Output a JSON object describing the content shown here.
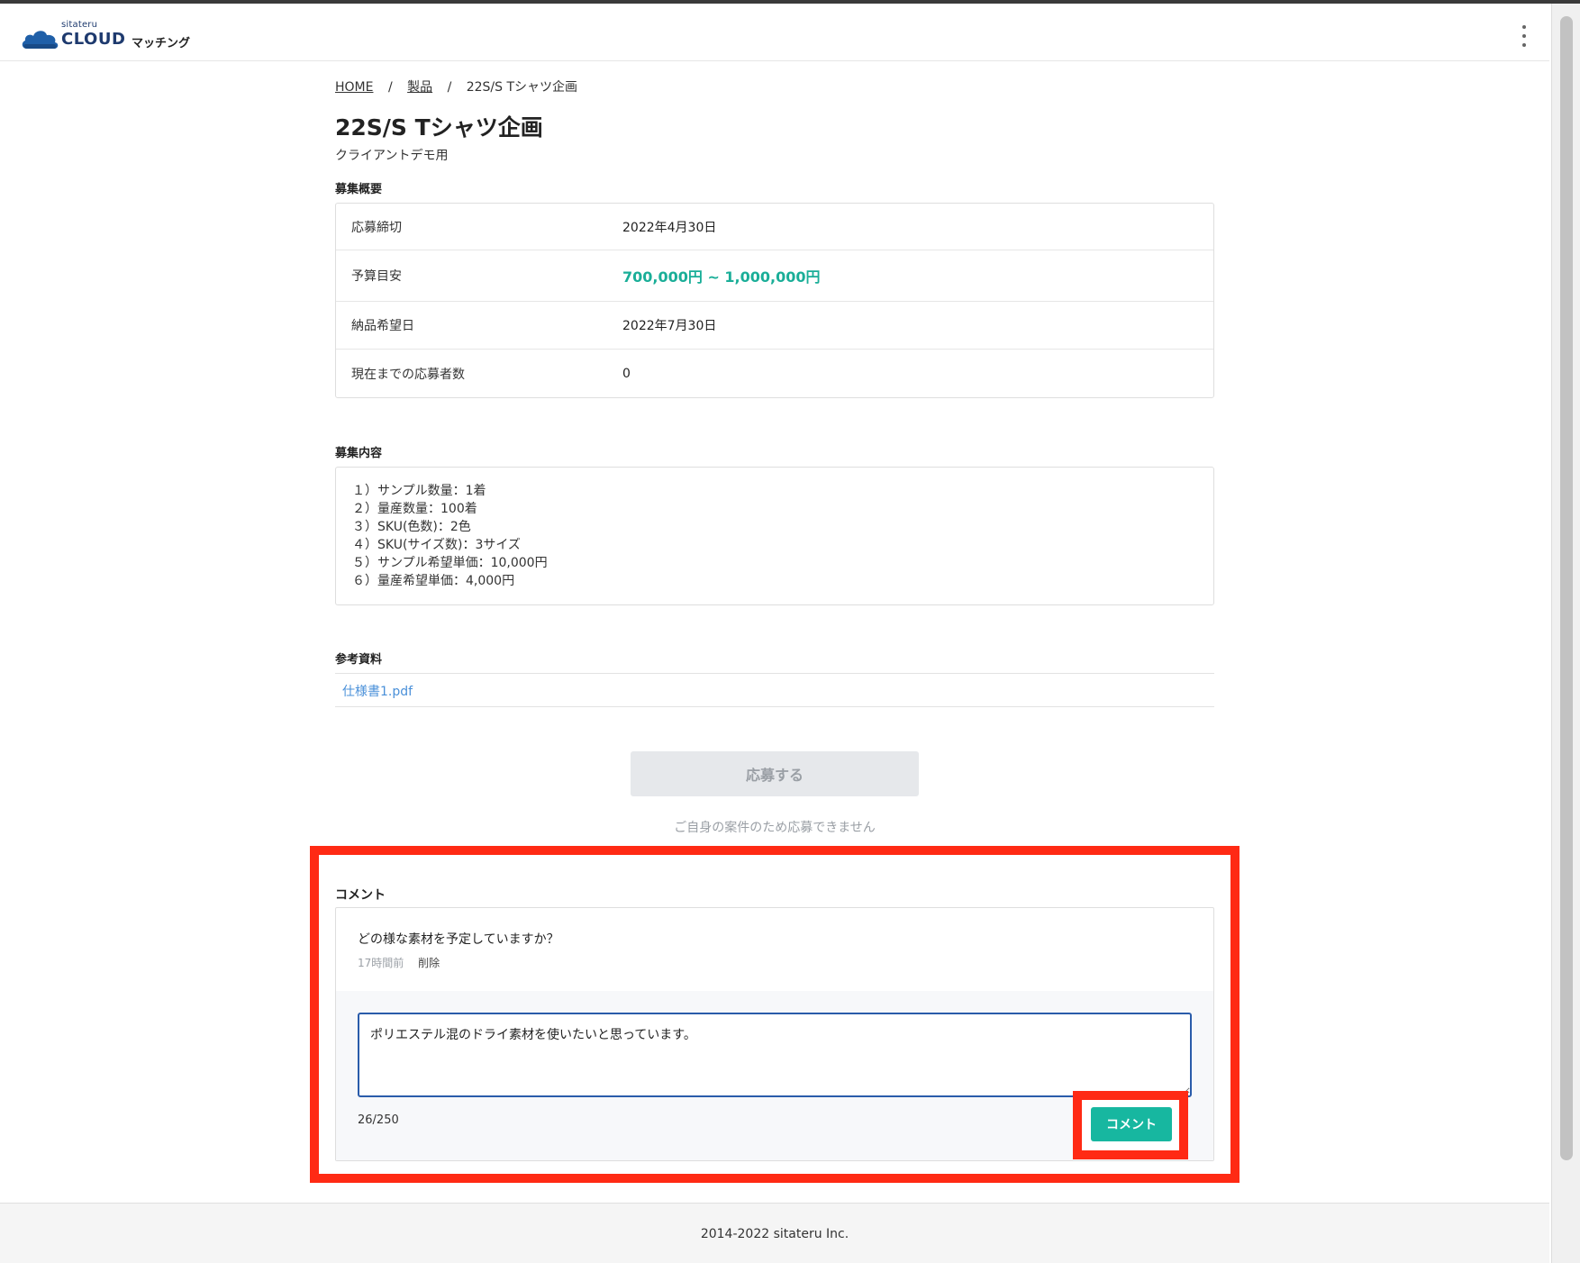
{
  "header": {
    "logo_small": "sitateru",
    "logo_big": "CLOUD",
    "logo_sub": "マッチング",
    "menu_icon": "kebab-menu-icon"
  },
  "breadcrumb": {
    "home": "HOME",
    "separator": "/",
    "products": "製品",
    "current": "22S/S Tシャツ企画"
  },
  "page": {
    "title": "22S/S Tシャツ企画",
    "subtitle": "クライアントデモ用"
  },
  "summary": {
    "heading": "募集概要",
    "rows": [
      {
        "label": "応募締切",
        "value": "2022年4月30日"
      },
      {
        "label": "予算目安",
        "value": "700,000円 ~ 1,000,000円"
      },
      {
        "label": "納品希望日",
        "value": "2022年7月30日"
      },
      {
        "label": "現在までの応募者数",
        "value": "0"
      }
    ]
  },
  "details": {
    "heading": "募集内容",
    "lines": [
      "１）サンプル数量：1着",
      "２）量産数量：100着",
      "３）SKU(色数)：2色",
      "４）SKU(サイズ数)：3サイズ",
      "５）サンプル希望単価：10,000円",
      "６）量産希望単価：4,000円"
    ]
  },
  "references": {
    "heading": "参考資料",
    "files": [
      "仕様書1.pdf"
    ]
  },
  "apply": {
    "button_label": "応募する",
    "note": "ご自身の案件のため応募できません"
  },
  "comments": {
    "heading": "コメント",
    "items": [
      {
        "text": "どの様な素材を予定していますか？",
        "time": "17時間前",
        "delete_label": "削除"
      }
    ],
    "reply_value": "ポリエステル混のドライ素材を使いたいと思っています。",
    "char_count": "26/250",
    "submit_label": "コメント"
  },
  "footer": {
    "copyright": "2014-2022 sitateru Inc."
  },
  "colors": {
    "accent": "#17b7a0",
    "budget": "#1aae98",
    "highlight": "#ff2a14",
    "link": "#4a90d9",
    "textarea_focus": "#2a5caa"
  }
}
